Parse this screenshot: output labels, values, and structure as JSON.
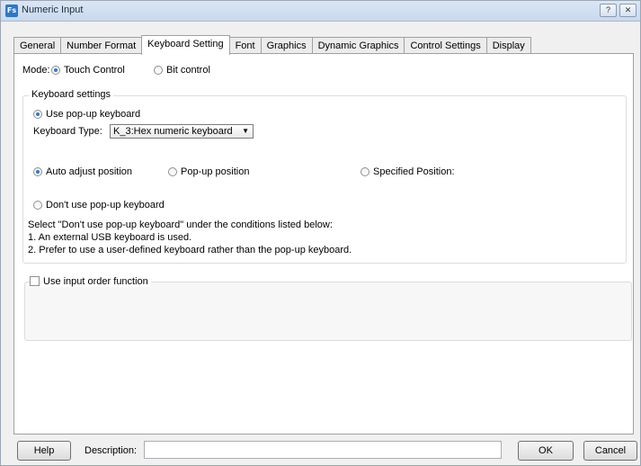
{
  "window": {
    "title": "Numeric Input",
    "app_icon_text": "Fs",
    "help_glyph": "?",
    "close_glyph": "✕"
  },
  "tabs": [
    "General",
    "Number Format",
    "Keyboard Setting",
    "Font",
    "Graphics",
    "Dynamic Graphics",
    "Control Settings",
    "Display"
  ],
  "active_tab": "Keyboard Setting",
  "mode": {
    "label": "Mode:",
    "options": [
      "Touch Control",
      "Bit control"
    ],
    "selected": "Touch Control"
  },
  "keyboard_settings": {
    "legend": "Keyboard settings",
    "use_popup_label": "Use pop-up keyboard",
    "use_popup_selected": true,
    "type_label": "Keyboard Type:",
    "type_value": "K_3:Hex numeric keyboard",
    "position_options": [
      "Auto adjust position",
      "Pop-up position",
      "Specified Position:"
    ],
    "position_selected": "Auto adjust position",
    "dont_use_label": "Don't use pop-up keyboard",
    "note_lines": [
      "Select \"Don't use pop-up keyboard\" under the conditions listed below:",
      "1. An external USB keyboard is used.",
      "2. Prefer to use a user-defined keyboard rather than the pop-up keyboard."
    ]
  },
  "input_order": {
    "label": "Use input order function",
    "checked": false
  },
  "footer": {
    "help_label": "Help",
    "description_label": "Description:",
    "description_value": "",
    "ok_label": "OK",
    "cancel_label": "Cancel"
  },
  "colors": {
    "accent": "#2c7ad6",
    "titlebar": "#c9d9ee"
  }
}
